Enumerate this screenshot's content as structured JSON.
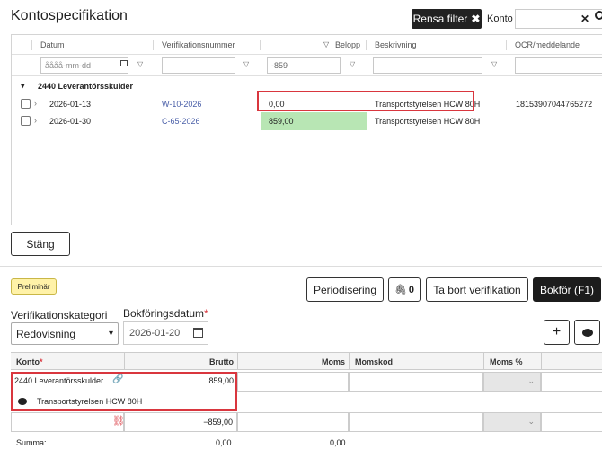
{
  "dialog": {
    "title": "Kontospecifikation",
    "clear_filter_label": "Rensa filter",
    "konto_label": "Konto",
    "konto_value": "",
    "close_button_label": "Stäng"
  },
  "grid": {
    "columns": [
      "Datum",
      "Verifikationsnummer",
      "Belopp",
      "Beskrivning",
      "OCR/meddelande"
    ],
    "filters": {
      "date_placeholder": "åååå-mm-dd",
      "verif_value": "",
      "amount_value": "-859",
      "desc_value": "",
      "ocr_value": ""
    },
    "group_label": "2440 Leverantörsskulder",
    "rows": [
      {
        "date": "2026-01-13",
        "verif": "W-10-2026",
        "amount": "0,00",
        "desc": "Transportstyrelsen HCW 80H",
        "ocr": "18153907044765272"
      },
      {
        "date": "2026-01-30",
        "verif": "C-65-2026",
        "amount": "859,00",
        "desc": "Transportstyrelsen HCW 80H",
        "ocr": ""
      }
    ]
  },
  "form": {
    "status_badge": "Preliminär",
    "buttons": {
      "periodisering": "Periodisering",
      "attachments_count": "0",
      "delete": "Ta bort verifikation",
      "book": "Bokför (F1)"
    },
    "verkat_label": "Verifikationskategori",
    "verkat_value": "Redovisning",
    "bokdat_label": "Bokföringsdatum",
    "bokdat_required": "*",
    "bokdat_value": "2026-01-20",
    "table": {
      "headers": {
        "konto": "Konto",
        "konto_required": "*",
        "brutto": "Brutto",
        "moms": "Moms",
        "momskod": "Momskod",
        "moms_pct": "Moms %"
      },
      "row1": {
        "konto": "2440 Leverantörsskulder",
        "brutto": "859,00",
        "comment": "Transportstyrelsen HCW 80H"
      },
      "row2": {
        "konto": "",
        "brutto": "−859,00"
      },
      "summa_label": "Summa:",
      "summa_brutto": "0,00",
      "summa_moms": "0,00"
    }
  }
}
